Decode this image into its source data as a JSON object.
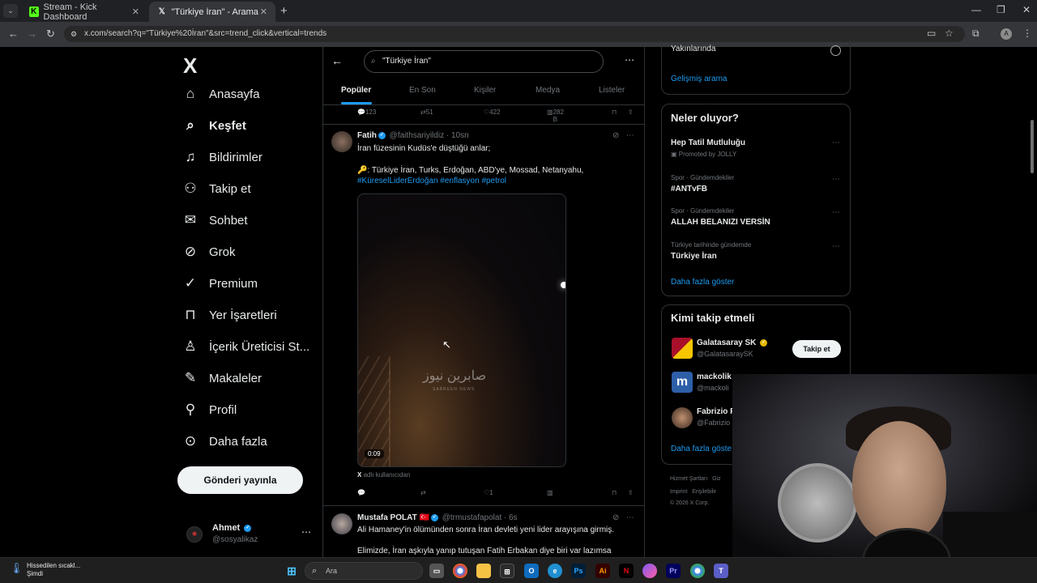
{
  "browser": {
    "tabs": [
      {
        "title": "Stream - Kick Dashboard",
        "favicon": "K"
      },
      {
        "title": "\"Türkiye İran\" - Arama / X",
        "favicon": "X"
      }
    ],
    "url": "x.com/search?q=\"Türkiye%20İran\"&src=trend_click&vertical=trends",
    "profile_initial": "A"
  },
  "nav": {
    "logo": "X",
    "items": [
      {
        "label": "Anasayfa",
        "icon": "home-icon",
        "glyph": "⌂"
      },
      {
        "label": "Keşfet",
        "icon": "search-icon",
        "glyph": "⌕"
      },
      {
        "label": "Bildirimler",
        "icon": "bell-icon",
        "glyph": "🔔"
      },
      {
        "label": "Takip et",
        "icon": "add-person-icon",
        "glyph": "👤"
      },
      {
        "label": "Sohbet",
        "icon": "mail-icon",
        "glyph": "✉"
      },
      {
        "label": "Grok",
        "icon": "grok-icon",
        "glyph": "⊘"
      },
      {
        "label": "Premium",
        "icon": "premium-icon",
        "glyph": "✓"
      },
      {
        "label": "Yer İşaretleri",
        "icon": "bookmark-icon",
        "glyph": "🔖"
      },
      {
        "label": "İçerik Üreticisi St...",
        "icon": "creator-icon",
        "glyph": "♙"
      },
      {
        "label": "Makaleler",
        "icon": "article-icon",
        "glyph": "✎"
      },
      {
        "label": "Profil",
        "icon": "profile-icon",
        "glyph": "👤"
      },
      {
        "label": "Daha fazla",
        "icon": "more-circle-icon",
        "glyph": "⋯"
      }
    ],
    "post_button": "Gönderi yayınla",
    "user": {
      "name": "Ahmet",
      "handle": "@sosyalikaz"
    }
  },
  "center": {
    "search_value": "\"Türkiye İran\"",
    "tabs": [
      "Popüler",
      "En Son",
      "Kişiler",
      "Medya",
      "Listeler"
    ],
    "prev_actions": {
      "replies": "123",
      "reposts": "51",
      "likes": "422",
      "views": "282 B"
    },
    "tweet1": {
      "name": "Fatih",
      "handle": "@faithsariyildiz",
      "time": "· 10sn",
      "line1": "İran füzesinin Kudüs'e düştüğü anlar;",
      "line2": "🔑: Türkiye İran, Turks, Erdoğan, ABD'ye, Mossad, Netanyahu,",
      "hashtags": "#KüreselLiderErdoğan #enflasyon #petrol",
      "video_watermark": "صابرين نيوز",
      "video_watermark_sub": "SABREEN NEWS",
      "duration": "0:09",
      "from_user_label": "adlı kullanıcıdan",
      "actions": {
        "likes": "1"
      }
    },
    "tweet2": {
      "name": "Mustafa POLAT 🇹🇷",
      "handle": "@trmustafapolat",
      "time": "· 6s",
      "line1": "Ali Hamaney'in ölümünden sonra İran devleti yeni lider arayışına girmiş.",
      "line2": "Elimizde, İran aşkıyla yanıp tutuşan Fatih Erbakan diye biri var lazımsa"
    }
  },
  "right": {
    "nearby": "Yakınlarında",
    "advanced_search": "Gelişmiş arama",
    "trends_title": "Neler oluyor?",
    "trends": [
      {
        "meta": "",
        "name": "Hep Tatil Mutluluğu",
        "sub": "Promoted by JOLLY"
      },
      {
        "meta": "Spor · Gündemdekiler",
        "name": "#ANTvFB",
        "sub": ""
      },
      {
        "meta": "Spor · Gündemdekiler",
        "name": "ALLAH BELANIZI VERSİN",
        "sub": ""
      },
      {
        "meta": "Türkiye tarihinde gündemde",
        "name": "Türkiye İran",
        "sub": ""
      }
    ],
    "show_more": "Daha fazla göster",
    "follow_title": "Kimi takip etmeli",
    "suggestions": [
      {
        "name": "Galatasaray SK",
        "handle": "@GalatasaraySK"
      },
      {
        "name": "mackolik",
        "handle": "@mackoli"
      },
      {
        "name": "Fabrizio R",
        "handle": "@Fabrizio"
      }
    ],
    "follow_button": "Takip et",
    "show_more2": "Daha fazla göste",
    "footer": {
      "l1a": "Hizmet Şartları",
      "l1b": "Giz",
      "l2a": "Imprint",
      "l2b": "Erişilebilir",
      "copy": "© 2026 X Corp."
    }
  },
  "taskbar": {
    "weather_title": "Hissedilen sıcakl...",
    "weather_sub": "Şimdi",
    "search_placeholder": "Ara"
  }
}
